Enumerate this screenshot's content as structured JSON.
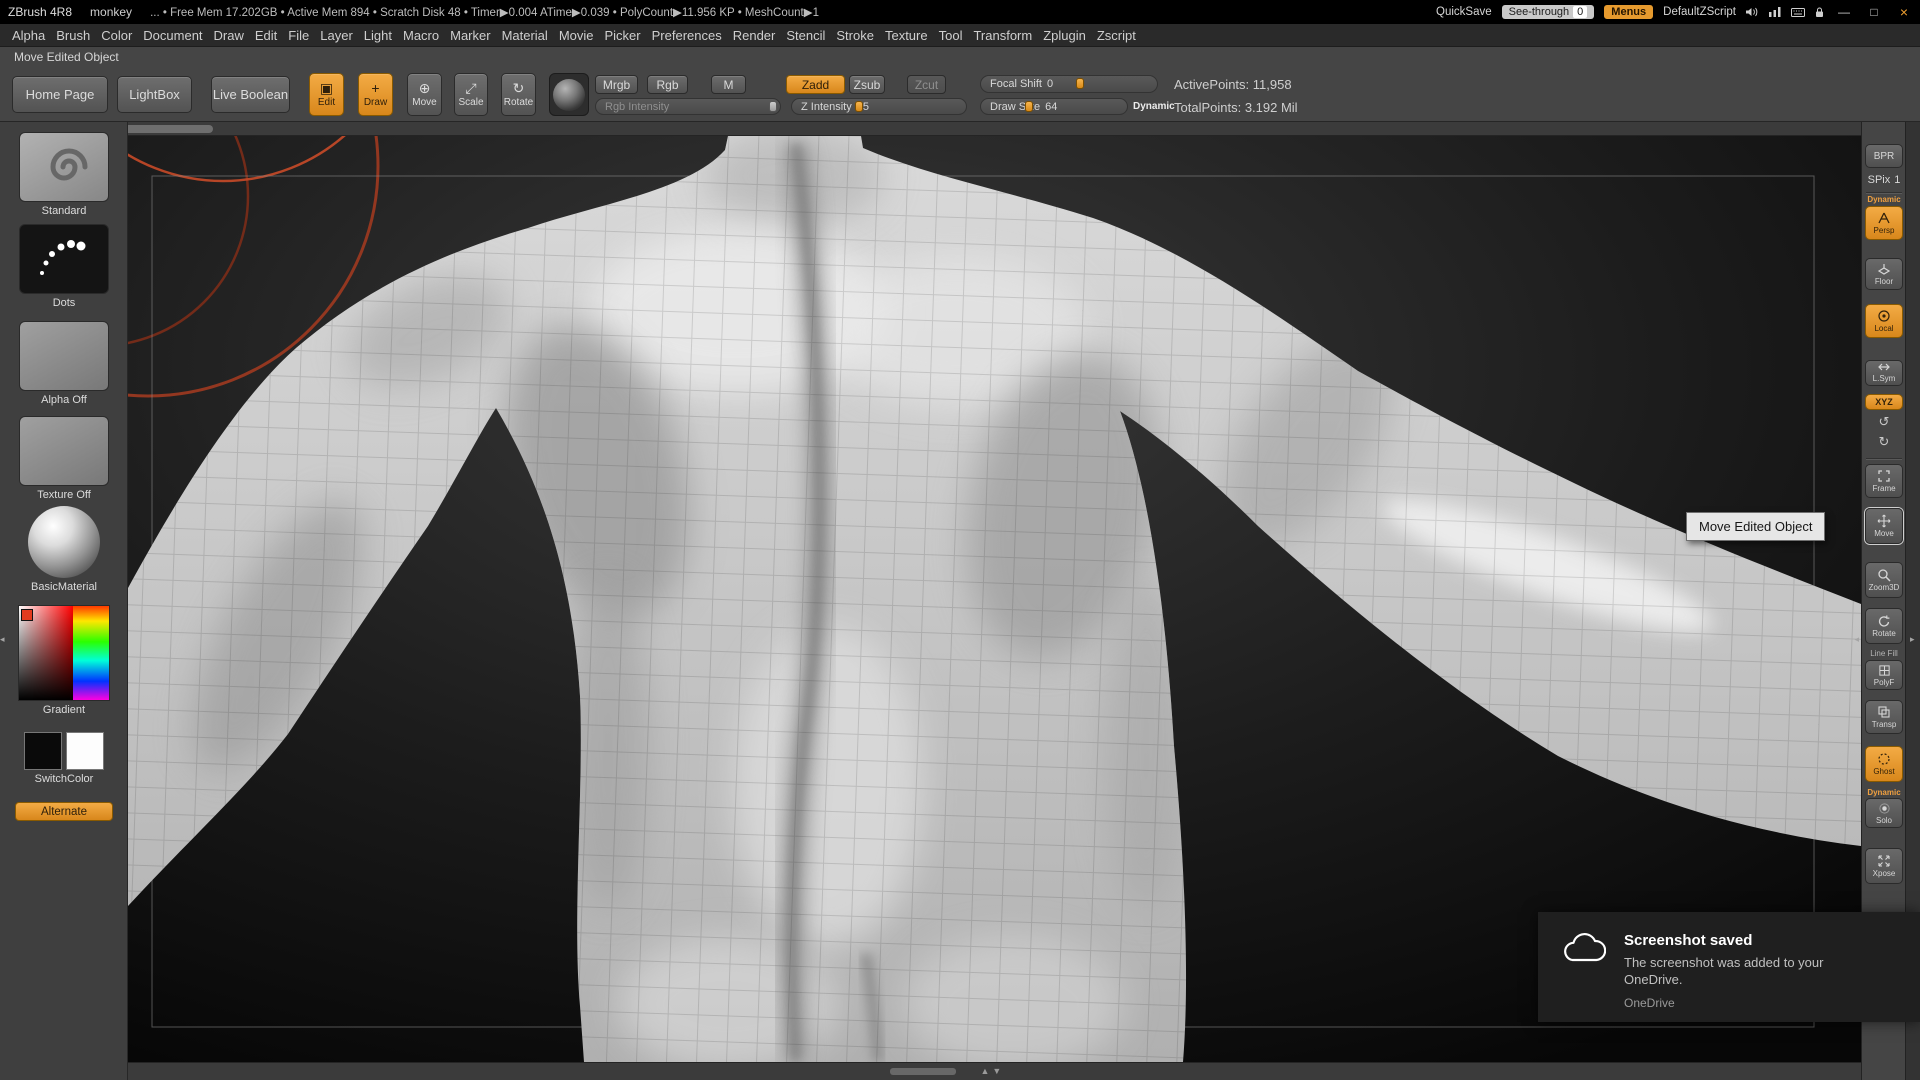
{
  "colors": {
    "accent_orange": "#e89a33",
    "ui_gray": "#454545",
    "canvas_bg": "#161616",
    "arc_red": "#a33a22",
    "toast_bg": "#1f1f1f"
  },
  "titlebar": {
    "app_title": "ZBrush 4R8",
    "doc_name": "monkey",
    "stats": "... • Free Mem 17.202GB • Active Mem 894 • Scratch Disk 48 • Timer▶0.004 ATime▶0.039 • PolyCount▶11.956 KP • MeshCount▶1",
    "quicksave": "QuickSave",
    "see_through_label": "See-through",
    "see_through_value": "0",
    "menus_label": "Menus",
    "zscript_name": "DefaultZScript",
    "minimize": "—",
    "maximize": "□",
    "close": "×"
  },
  "menubar": {
    "items": [
      "Alpha",
      "Brush",
      "Color",
      "Document",
      "Draw",
      "Edit",
      "File",
      "Layer",
      "Light",
      "Macro",
      "Marker",
      "Material",
      "Movie",
      "Picker",
      "Preferences",
      "Render",
      "Stencil",
      "Stroke",
      "Texture",
      "Tool",
      "Transform",
      "Zplugin",
      "Zscript"
    ]
  },
  "shelf": {
    "hint": "Move Edited Object",
    "home_page": "Home Page",
    "lightbox": "LightBox",
    "live_boolean": "Live Boolean",
    "edit": "Edit",
    "draw": "Draw",
    "move": "Move",
    "scale": "Scale",
    "rotate": "Rotate",
    "mrgb": "Mrgb",
    "rgb": "Rgb",
    "m": "M",
    "rgb_intensity_label": "Rgb Intensity",
    "zadd": "Zadd",
    "zsub": "Zsub",
    "zcut": "Zcut",
    "z_intensity_label": "Z Intensity",
    "z_intensity_value": "25",
    "focal_shift_label": "Focal Shift",
    "focal_shift_value": "0",
    "draw_size_label": "Draw Size",
    "draw_size_value": "64",
    "dynamic_label": "Dynamic",
    "active_points": "ActivePoints: 11,958",
    "total_points": "TotalPoints: 3.192 Mil"
  },
  "left_panel": {
    "standard": "Standard",
    "dots": "Dots",
    "alpha_off": "Alpha Off",
    "texture_off": "Texture Off",
    "basic_material": "BasicMaterial",
    "gradient": "Gradient",
    "switch_color": "SwitchColor",
    "alternate": "Alternate"
  },
  "right_rail": {
    "bpr": "BPR",
    "spix_label": "SPix",
    "spix_value": "1",
    "dynamic_persp": "Dynamic",
    "persp": "Persp",
    "floor": "Floor",
    "local": "Local",
    "lsym": "L.Sym",
    "xyz": "XYZ",
    "frame": "Frame",
    "move": "Move",
    "zoom3d": "Zoom3D",
    "rotate": "Rotate",
    "line_fill": "Line Fill",
    "polyf": "PolyF",
    "transp": "Transp",
    "ghost": "Ghost",
    "dynamic_solo": "Dynamic",
    "solo": "Solo",
    "xpose": "Xpose"
  },
  "canvas": {
    "tooltip": "Move Edited Object"
  },
  "toast": {
    "title": "Screenshot saved",
    "body": "The screenshot was added to your OneDrive.",
    "app_name": "OneDrive"
  },
  "glyphs": {
    "edit": "▣",
    "draw": "+",
    "move": "⊕",
    "scale": "⤢",
    "rotate": "↻",
    "spiral_ccw": "↺",
    "spiral_cw": "↻",
    "collapse_left": "◂",
    "collapse_right": "▸",
    "scroll_up": "▲",
    "scroll_down": "▼"
  }
}
